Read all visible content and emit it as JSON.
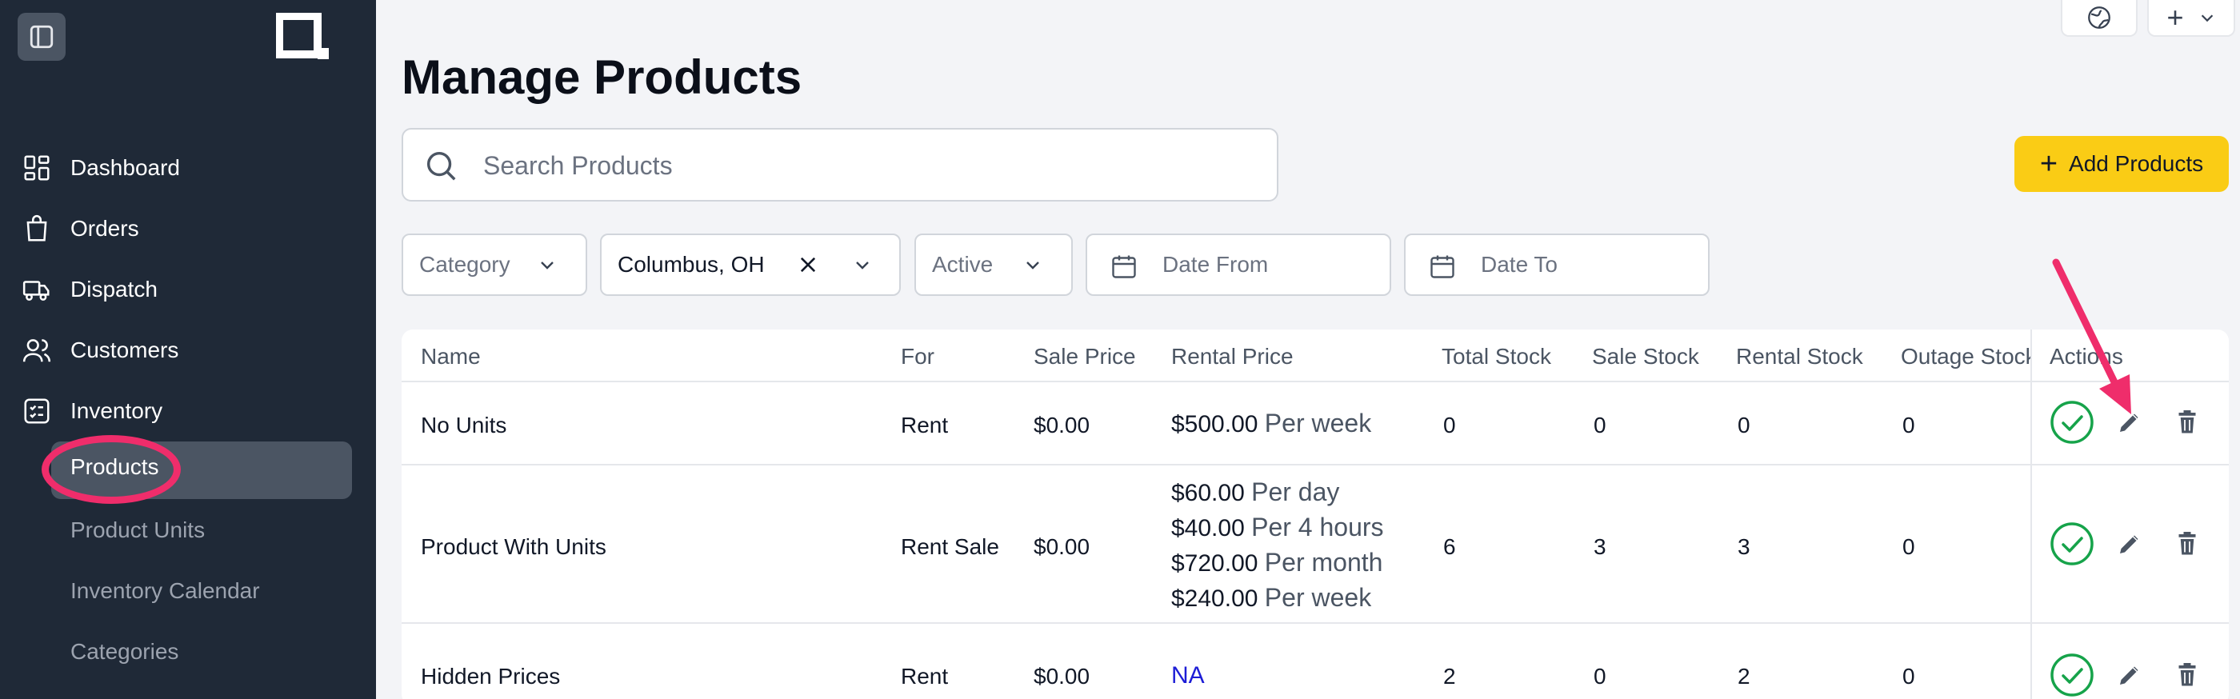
{
  "sidebar": {
    "toggle_icon": "sidebar-toggle-icon",
    "logo_icon": "brand-logo-icon",
    "nav": [
      {
        "label": "Dashboard",
        "icon": "dashboard-icon"
      },
      {
        "label": "Orders",
        "icon": "shopping-bag-icon"
      },
      {
        "label": "Dispatch",
        "icon": "truck-icon"
      },
      {
        "label": "Customers",
        "icon": "users-icon"
      },
      {
        "label": "Inventory",
        "icon": "checklist-icon"
      }
    ],
    "sub_items": [
      "Products",
      "Product Units",
      "Inventory Calendar",
      "Categories"
    ],
    "active_sub": "Products"
  },
  "header": {
    "title": "Manage Products",
    "search_placeholder": "Search Products",
    "add_button_label": "Add Products"
  },
  "filters": {
    "category": "Category",
    "location": "Columbus, OH",
    "status": "Active",
    "date_from": "Date From",
    "date_to": "Date To"
  },
  "table": {
    "columns": [
      "Name",
      "For",
      "Sale Price",
      "Rental Price",
      "Total Stock",
      "Sale Stock",
      "Rental Stock",
      "Outage Stock",
      "Actions"
    ],
    "rows": [
      {
        "name": "No Units",
        "for": "Rent",
        "sale_price": "$0.00",
        "rental_prices": [
          {
            "amount": "$500.00",
            "unit": "Per week"
          }
        ],
        "total_stock": "0",
        "sale_stock": "0",
        "rental_stock": "0",
        "outage_stock": "0"
      },
      {
        "name": "Product With Units",
        "for": "Rent Sale",
        "sale_price": "$0.00",
        "rental_prices": [
          {
            "amount": "$60.00",
            "unit": "Per day"
          },
          {
            "amount": "$40.00",
            "unit": "Per 4 hours"
          },
          {
            "amount": "$720.00",
            "unit": "Per month"
          },
          {
            "amount": "$240.00",
            "unit": "Per week"
          }
        ],
        "total_stock": "6",
        "sale_stock": "3",
        "rental_stock": "3",
        "outage_stock": "0"
      },
      {
        "name": "Hidden Prices",
        "for": "Rent",
        "sale_price": "$0.00",
        "rental_na": "NA",
        "total_stock": "2",
        "sale_stock": "0",
        "rental_stock": "2",
        "outage_stock": "0"
      }
    ]
  },
  "colors": {
    "sidebar_bg": "#1f2937",
    "accent_yellow": "#facc15",
    "active_check": "#16a34a",
    "annotation": "#ef2d6b",
    "na_link": "#1d1dd6"
  }
}
